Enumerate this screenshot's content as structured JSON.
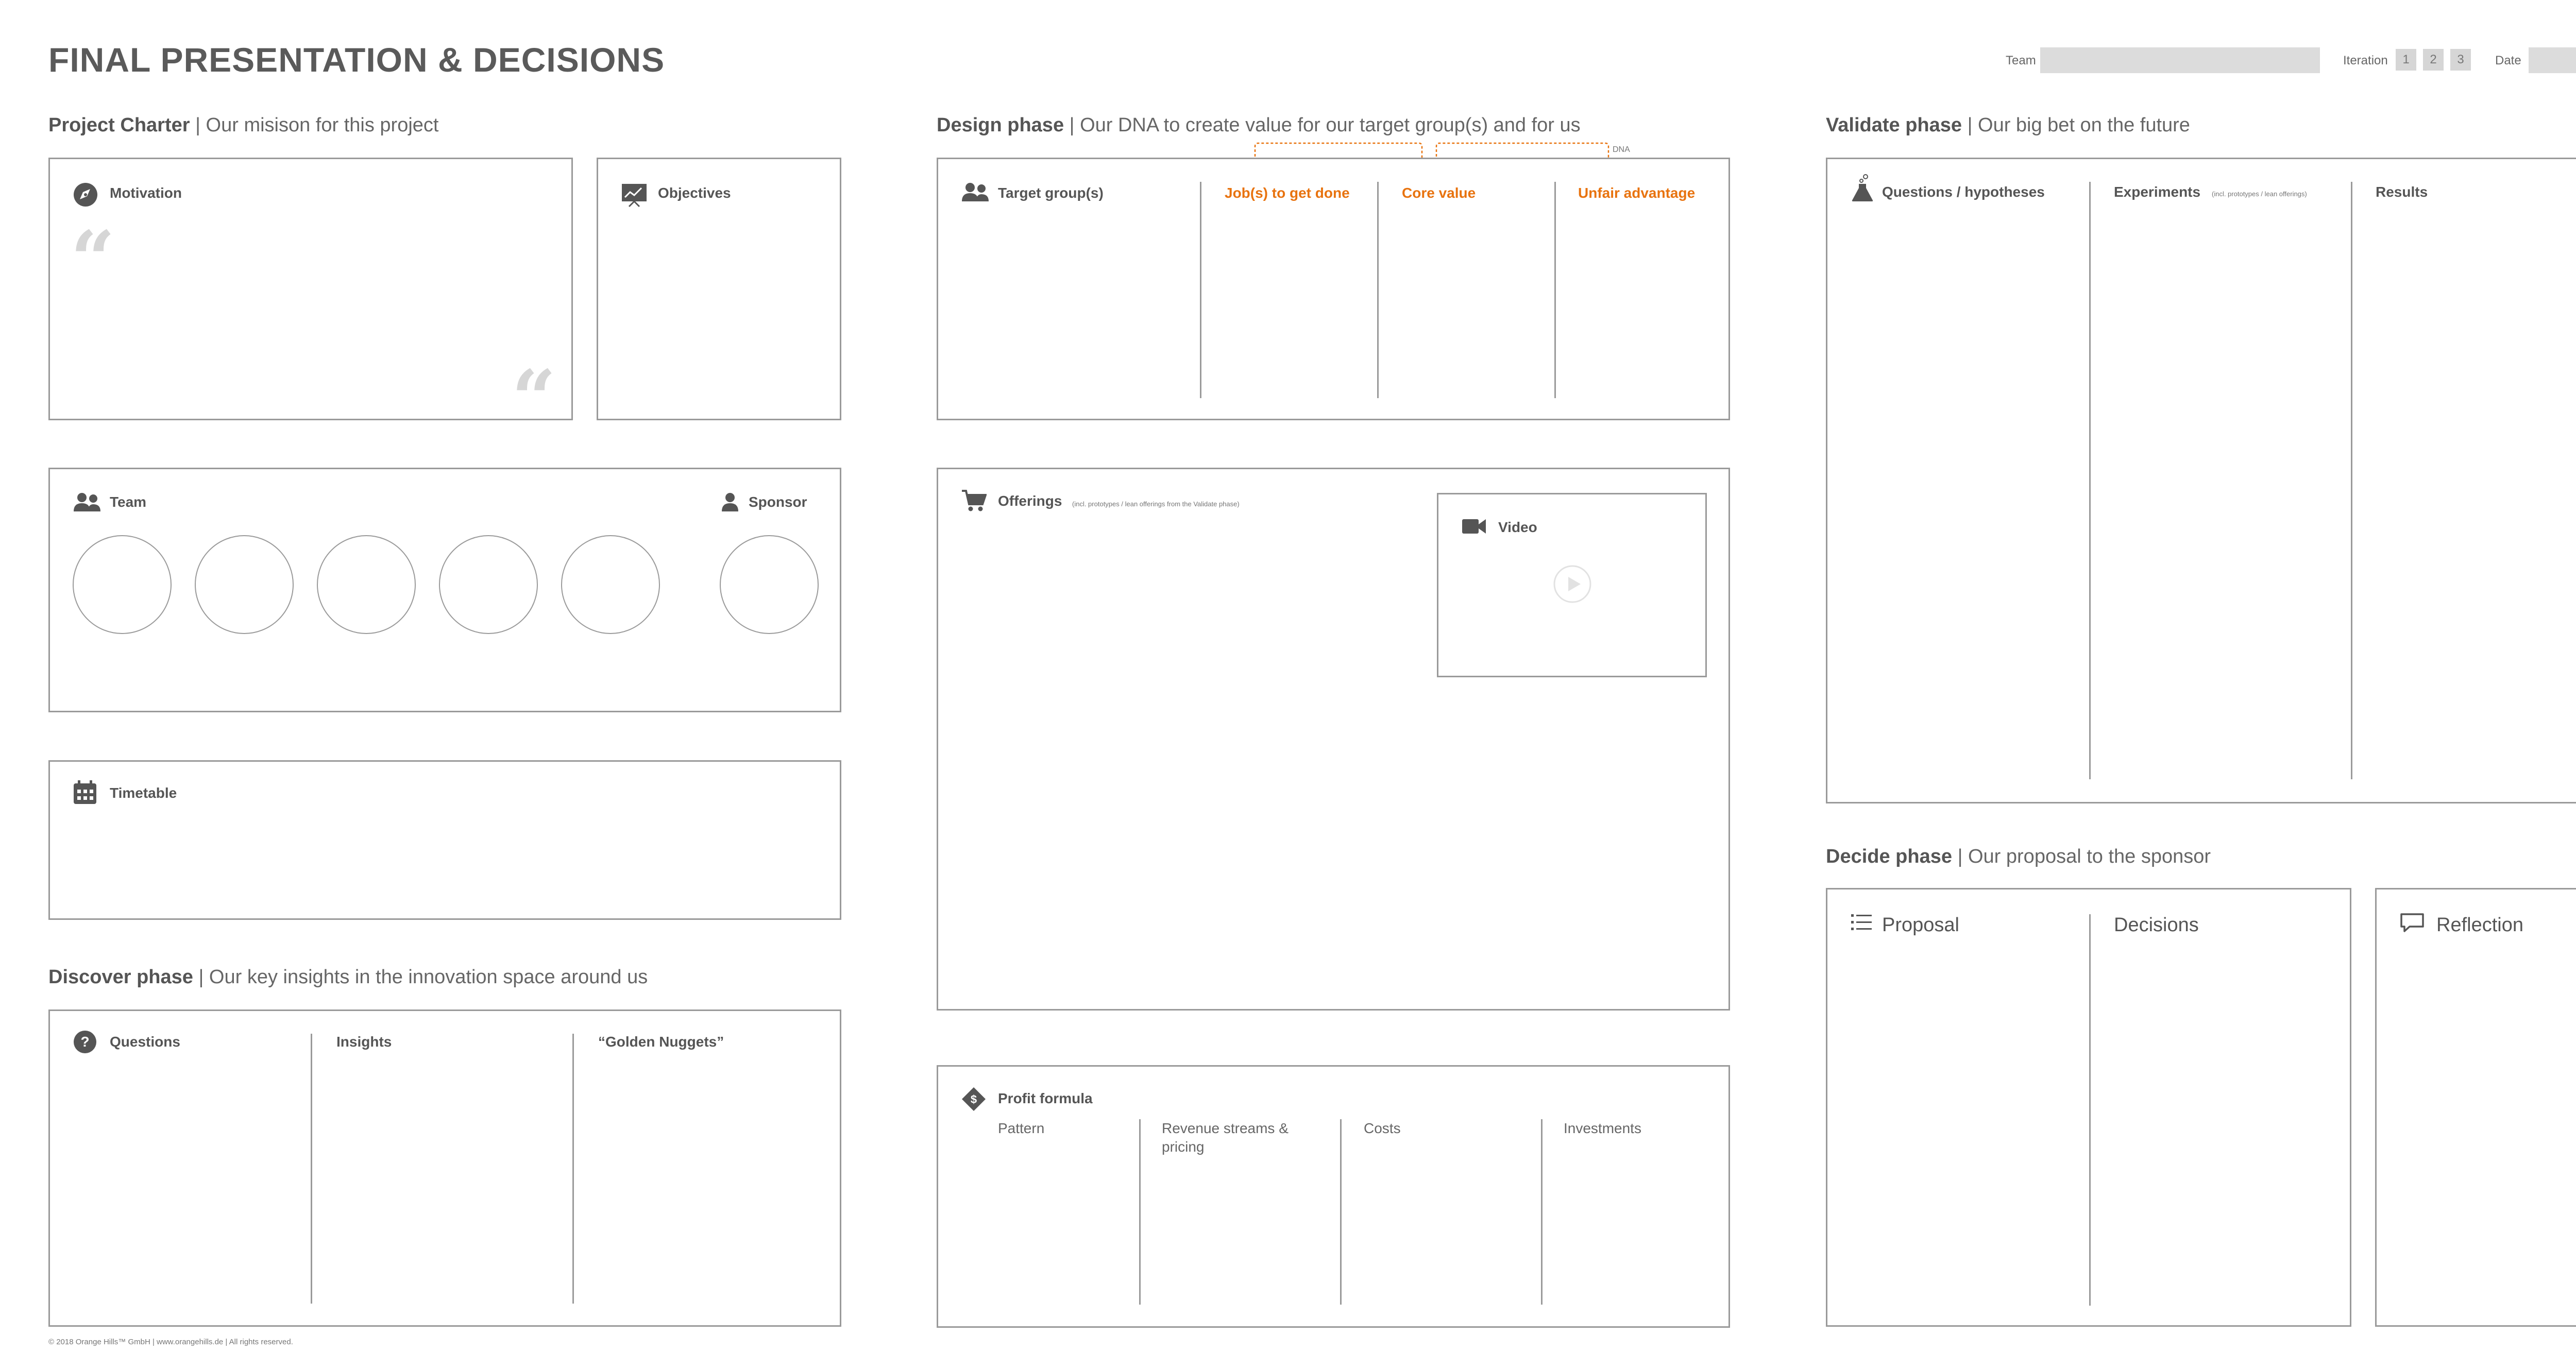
{
  "header": {
    "title": "FINAL PRESENTATION & DECISIONS",
    "team_label": "Team",
    "iteration_label": "Iteration",
    "iterations": [
      "1",
      "2",
      "3"
    ],
    "date_label": "Date"
  },
  "project_charter": {
    "heading": "Project Charter",
    "subheading": "| Our misison for this project",
    "motivation": "Motivation",
    "quote_open": "“",
    "quote_close": "“",
    "objectives": "Objectives",
    "team": "Team",
    "sponsor": "Sponsor",
    "timetable": "Timetable"
  },
  "discover_phase": {
    "heading": "Discover phase",
    "subheading": "| Our key insights in the innovation space around us",
    "columns": [
      "Questions",
      "Insights",
      "“Golden Nuggets”"
    ]
  },
  "design_phase": {
    "heading": "Design phase",
    "subheading": "| Our DNA to create value for our target group(s) and for us",
    "target_groups": "Target group(s)",
    "jobs": "Job(s) to get done",
    "core_value": "Core value",
    "unfair_advantage": "Unfair advantage",
    "dna": "DNA",
    "offerings": "Offerings",
    "offerings_note": "(incl. prototypes / lean offerings from the Validate phase)",
    "video": "Video",
    "profit_formula": "Profit formula",
    "profit_columns": [
      "Pattern",
      "Revenue streams & pricing",
      "Costs",
      "Investments"
    ]
  },
  "validate_phase": {
    "heading": "Validate phase",
    "subheading": "| Our big bet on the future",
    "questions": "Questions  / hypotheses",
    "experiments": "Experiments",
    "experiments_note": "(incl. prototypes / lean offerings)",
    "results": "Results"
  },
  "decide_phase": {
    "heading": "Decide phase",
    "subheading": "| Our proposal to the sponsor",
    "proposal": "Proposal",
    "decisions": "Decisions",
    "reflection": "Reflection"
  },
  "footer": "© 2018 Orange Hills™ GmbH | www.orangehills.de | All rights reserved.",
  "colors": {
    "accent": "#e8730f",
    "border": "#9a9a9a",
    "text": "#555555",
    "field": "#dcdcdc"
  }
}
